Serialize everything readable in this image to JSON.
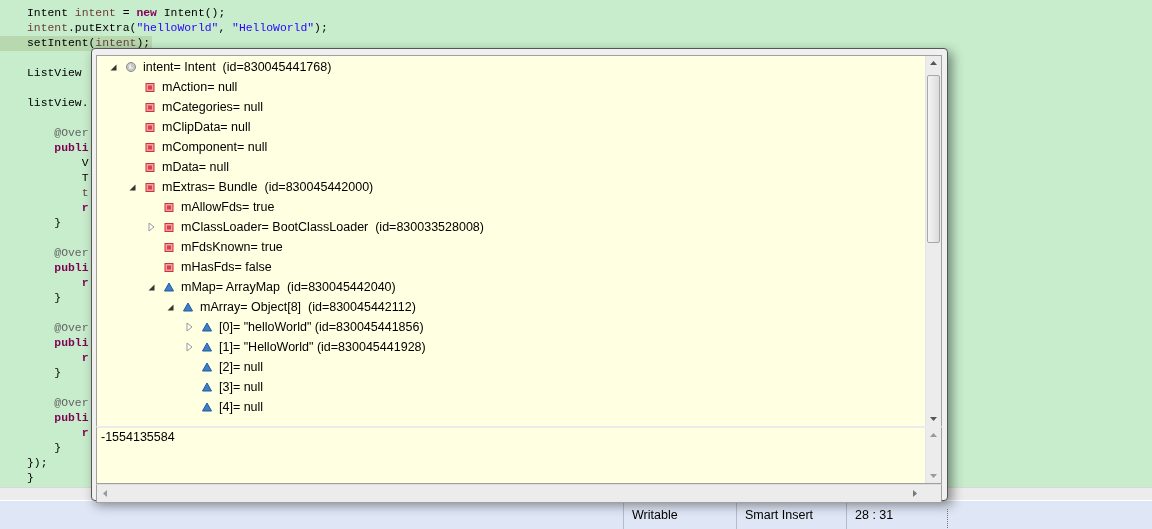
{
  "editor": {
    "lines": [
      {
        "current": false,
        "tokens": [
          {
            "kind": "type",
            "text": "Intent "
          },
          {
            "kind": "local",
            "text": "intent"
          },
          {
            "kind": "plain",
            "text": " = "
          },
          {
            "kind": "keyword",
            "text": "new"
          },
          {
            "kind": "plain",
            "text": " Intent();"
          }
        ]
      },
      {
        "current": false,
        "tokens": [
          {
            "kind": "local",
            "text": "intent"
          },
          {
            "kind": "plain",
            "text": ".putExtra("
          },
          {
            "kind": "string",
            "text": "\"helloWorld\""
          },
          {
            "kind": "plain",
            "text": ", "
          },
          {
            "kind": "string",
            "text": "\"HelloWorld\""
          },
          {
            "kind": "plain",
            "text": ");"
          }
        ]
      },
      {
        "current": true,
        "tokens": [
          {
            "kind": "plain",
            "text": "setIntent("
          },
          {
            "kind": "local",
            "text": "intent"
          },
          {
            "kind": "plain",
            "text": ");"
          }
        ]
      },
      {
        "current": false
      },
      {
        "current": false,
        "tokens": [
          {
            "kind": "plain",
            "text": "ListView"
          }
        ]
      },
      {
        "current": false
      },
      {
        "current": false,
        "tokens": [
          {
            "kind": "plain",
            "text": "listView."
          }
        ]
      },
      {
        "current": false
      },
      {
        "current": false,
        "tokens": [
          {
            "kind": "annotation",
            "text": "    @Over"
          }
        ]
      },
      {
        "current": false,
        "tokens": [
          {
            "kind": "keyword",
            "text": "    publi"
          }
        ]
      },
      {
        "current": false,
        "tokens": [
          {
            "kind": "plain",
            "text": "        V"
          }
        ]
      },
      {
        "current": false,
        "tokens": [
          {
            "kind": "plain",
            "text": "        T"
          }
        ]
      },
      {
        "current": false,
        "tokens": [
          {
            "kind": "local",
            "text": "        t"
          }
        ]
      },
      {
        "current": false,
        "tokens": [
          {
            "kind": "keyword",
            "text": "        r"
          }
        ]
      },
      {
        "current": false,
        "tokens": [
          {
            "kind": "plain",
            "text": "    }"
          }
        ]
      },
      {
        "current": false
      },
      {
        "current": false,
        "tokens": [
          {
            "kind": "annotation",
            "text": "    @Over"
          }
        ]
      },
      {
        "current": false,
        "tokens": [
          {
            "kind": "keyword",
            "text": "    publi"
          }
        ]
      },
      {
        "current": false,
        "tokens": [
          {
            "kind": "keyword",
            "text": "        r"
          }
        ]
      },
      {
        "current": false,
        "tokens": [
          {
            "kind": "plain",
            "text": "    }"
          }
        ]
      },
      {
        "current": false
      },
      {
        "current": false,
        "tokens": [
          {
            "kind": "annotation",
            "text": "    @Over"
          }
        ]
      },
      {
        "current": false,
        "tokens": [
          {
            "kind": "keyword",
            "text": "    publi"
          }
        ]
      },
      {
        "current": false,
        "tokens": [
          {
            "kind": "keyword",
            "text": "        r"
          }
        ]
      },
      {
        "current": false,
        "tokens": [
          {
            "kind": "plain",
            "text": "    }"
          }
        ]
      },
      {
        "current": false
      },
      {
        "current": false,
        "tokens": [
          {
            "kind": "annotation",
            "text": "    @Over"
          }
        ]
      },
      {
        "current": false,
        "tokens": [
          {
            "kind": "keyword",
            "text": "    publi"
          }
        ]
      },
      {
        "current": false,
        "tokens": [
          {
            "kind": "keyword",
            "text": "        r"
          }
        ]
      },
      {
        "current": false,
        "tokens": [
          {
            "kind": "plain",
            "text": "    }"
          }
        ]
      },
      {
        "current": false,
        "tokens": [
          {
            "kind": "plain",
            "text": "});"
          }
        ]
      },
      {
        "current": false,
        "tokens": [
          {
            "kind": "plain",
            "text": "}"
          }
        ]
      }
    ]
  },
  "inspector": {
    "tree": [
      {
        "kind": "local",
        "label": "intent= Intent  (id=830045441768)",
        "expanded": true,
        "children": [
          {
            "kind": "private",
            "label": "mAction= null"
          },
          {
            "kind": "private",
            "label": "mCategories= null"
          },
          {
            "kind": "private",
            "label": "mClipData= null"
          },
          {
            "kind": "private",
            "label": "mComponent= null"
          },
          {
            "kind": "private",
            "label": "mData= null"
          },
          {
            "kind": "private",
            "label": "mExtras= Bundle  (id=830045442000)",
            "expanded": true,
            "children": [
              {
                "kind": "private",
                "label": "mAllowFds= true"
              },
              {
                "kind": "private",
                "label": "mClassLoader= BootClassLoader  (id=830033528008)",
                "expanded": false
              },
              {
                "kind": "private",
                "label": "mFdsKnown= true"
              },
              {
                "kind": "private",
                "label": "mHasFds= false"
              },
              {
                "kind": "default",
                "label": "mMap= ArrayMap  (id=830045442040)",
                "expanded": true,
                "children": [
                  {
                    "kind": "default",
                    "label": "mArray= Object[8]  (id=830045442112)",
                    "expanded": true,
                    "children": [
                      {
                        "kind": "default",
                        "label": "[0]= \"helloWorld\" (id=830045441856)",
                        "expanded": false
                      },
                      {
                        "kind": "default",
                        "label": "[1]= \"HelloWorld\" (id=830045441928)",
                        "expanded": false
                      },
                      {
                        "kind": "default",
                        "label": "[2]= null"
                      },
                      {
                        "kind": "default",
                        "label": "[3]= null"
                      },
                      {
                        "kind": "default",
                        "label": "[4]= null"
                      }
                    ]
                  }
                ]
              }
            ]
          }
        ]
      }
    ],
    "detail": "-1554135584"
  },
  "status_bar": {
    "fields": [
      "Writable",
      "Smart Insert",
      "28 : 31"
    ]
  }
}
